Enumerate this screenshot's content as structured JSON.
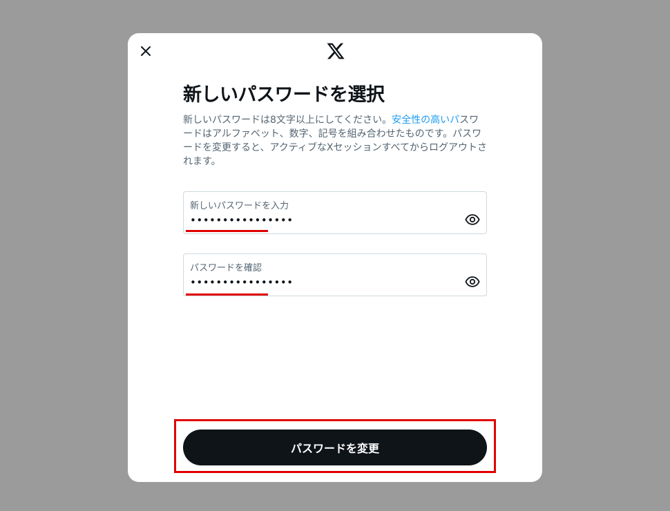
{
  "header": {
    "close_icon": "close-icon",
    "logo_icon": "x-logo-icon"
  },
  "main": {
    "title": "新しいパスワードを選択",
    "description_before": "新しいパスワードは8文字以上にしてください。",
    "description_link": "安全性の高いパ",
    "description_after": "スワードはアルファベット、数字、記号を組み合わせたものです。パスワードを変更すると、アクティブなXセッションすべてからログアウトされます。"
  },
  "fields": [
    {
      "label": "新しいパスワードを入力",
      "value": "••••••••••••••••",
      "icon": "eye-icon"
    },
    {
      "label": "パスワードを確認",
      "value": "••••••••••••••••",
      "icon": "eye-icon"
    }
  ],
  "actions": {
    "submit_label": "パスワードを変更"
  },
  "colors": {
    "overlay": "#9b9b9b",
    "text_primary": "#0f1419",
    "text_secondary": "#536471",
    "link": "#1d9bf0",
    "button_bg": "#0f1419",
    "highlight": "#e00000"
  }
}
